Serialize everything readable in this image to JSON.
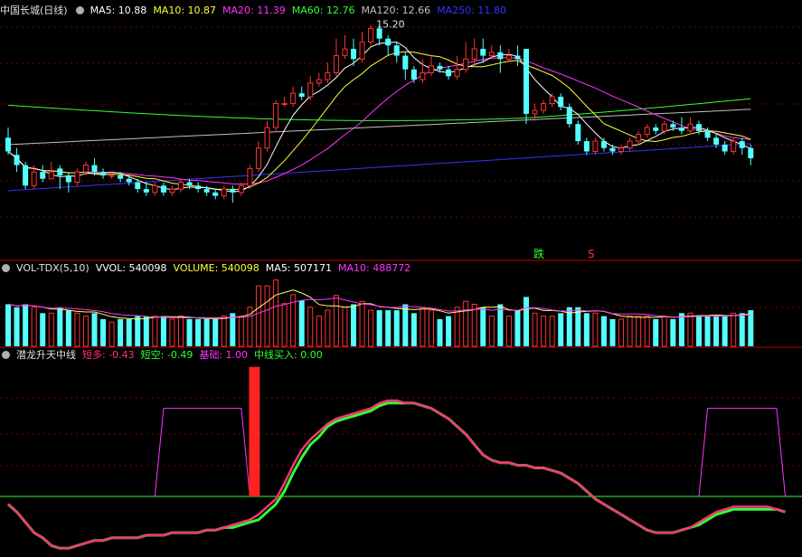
{
  "chart_data": [
    {
      "type": "candlestick",
      "title": "中国长城(日线)",
      "legend": [
        {
          "label": "MA5: 10.88",
          "color": "#ffffff"
        },
        {
          "label": "MA10: 10.87",
          "color": "#ffff33"
        },
        {
          "label": "MA20: 11.39",
          "color": "#ff33ff"
        },
        {
          "label": "MA60: 12.76",
          "color": "#33ff33"
        },
        {
          "label": "MA120: 12.66",
          "color": "#c0c0c0"
        },
        {
          "label": "MA250: 11.80",
          "color": "#3333ff"
        }
      ],
      "ylim": [
        9.0,
        15.4
      ],
      "high_label": "15.20",
      "signals": [
        {
          "text": "跌",
          "color": "#33ff33"
        },
        {
          "text": "S",
          "color": "#ff3333"
        }
      ],
      "candles": [
        [
          11.9,
          11.5,
          12.2,
          11.4
        ],
        [
          11.4,
          11.1,
          11.6,
          10.9
        ],
        [
          11.1,
          10.5,
          11.2,
          10.4
        ],
        [
          10.5,
          10.9,
          11.1,
          10.4
        ],
        [
          10.9,
          10.7,
          11.1,
          10.6
        ],
        [
          10.7,
          10.9,
          11.2,
          10.7
        ],
        [
          11.0,
          10.8,
          11.1,
          10.4
        ],
        [
          10.8,
          10.6,
          10.9,
          10.3
        ],
        [
          10.6,
          10.9,
          11.0,
          10.5
        ],
        [
          10.9,
          11.1,
          11.2,
          10.8
        ],
        [
          11.1,
          10.9,
          11.3,
          10.8
        ],
        [
          10.9,
          10.8,
          11.0,
          10.7
        ],
        [
          10.8,
          10.8,
          10.9,
          10.7
        ],
        [
          10.8,
          10.7,
          10.9,
          10.6
        ],
        [
          10.7,
          10.6,
          10.8,
          10.5
        ],
        [
          10.6,
          10.4,
          10.7,
          10.3
        ],
        [
          10.4,
          10.3,
          10.6,
          10.2
        ],
        [
          10.3,
          10.5,
          10.6,
          10.2
        ],
        [
          10.5,
          10.3,
          10.6,
          10.2
        ],
        [
          10.3,
          10.4,
          10.5,
          10.2
        ],
        [
          10.4,
          10.6,
          10.7,
          10.3
        ],
        [
          10.6,
          10.5,
          10.7,
          10.4
        ],
        [
          10.5,
          10.4,
          10.6,
          10.3
        ],
        [
          10.4,
          10.3,
          10.5,
          10.2
        ],
        [
          10.3,
          10.2,
          10.4,
          10.1
        ],
        [
          10.2,
          10.4,
          10.5,
          10.1
        ],
        [
          10.4,
          10.3,
          10.5,
          10.0
        ],
        [
          10.3,
          10.5,
          10.6,
          10.2
        ],
        [
          10.5,
          11.0,
          11.1,
          10.4
        ],
        [
          11.0,
          11.6,
          11.8,
          10.9
        ],
        [
          11.6,
          12.2,
          12.4,
          11.5
        ],
        [
          12.2,
          12.9,
          13.0,
          12.1
        ],
        [
          12.9,
          12.9,
          13.1,
          12.8
        ],
        [
          12.9,
          13.2,
          13.4,
          12.8
        ],
        [
          13.2,
          13.1,
          13.4,
          13.0
        ],
        [
          13.1,
          13.5,
          13.7,
          13.0
        ],
        [
          13.5,
          13.6,
          13.8,
          13.4
        ],
        [
          13.6,
          13.8,
          14.1,
          13.5
        ],
        [
          13.8,
          14.3,
          14.8,
          13.7
        ],
        [
          14.3,
          14.5,
          14.9,
          14.2
        ],
        [
          14.5,
          14.2,
          14.8,
          14.0
        ],
        [
          14.2,
          14.7,
          15.0,
          14.1
        ],
        [
          14.7,
          15.1,
          15.2,
          14.6
        ],
        [
          15.1,
          14.8,
          15.2,
          14.6
        ],
        [
          14.8,
          14.6,
          14.9,
          14.3
        ],
        [
          14.6,
          14.3,
          14.7,
          14.1
        ],
        [
          14.3,
          13.9,
          14.4,
          13.6
        ],
        [
          13.9,
          13.6,
          14.0,
          13.5
        ],
        [
          13.6,
          13.8,
          14.2,
          13.5
        ],
        [
          13.8,
          14.0,
          14.3,
          13.7
        ],
        [
          14.0,
          13.9,
          14.1,
          13.8
        ],
        [
          13.9,
          13.7,
          14.0,
          13.6
        ],
        [
          13.7,
          13.9,
          14.3,
          13.6
        ],
        [
          13.9,
          14.2,
          14.7,
          13.8
        ],
        [
          14.2,
          14.5,
          14.8,
          14.0
        ],
        [
          14.5,
          14.3,
          14.8,
          14.1
        ],
        [
          14.3,
          14.4,
          14.6,
          14.2
        ],
        [
          14.4,
          14.2,
          14.6,
          13.8
        ],
        [
          14.2,
          14.3,
          14.5,
          14.1
        ],
        [
          14.3,
          14.2,
          14.6,
          14.0
        ],
        [
          14.5,
          12.6,
          14.5,
          12.3
        ],
        [
          12.6,
          12.7,
          12.9,
          12.4
        ],
        [
          12.7,
          12.9,
          13.0,
          12.6
        ],
        [
          12.9,
          13.1,
          13.2,
          12.8
        ],
        [
          13.1,
          12.8,
          13.2,
          12.7
        ],
        [
          12.8,
          12.3,
          12.9,
          12.2
        ],
        [
          12.3,
          11.8,
          12.4,
          11.7
        ],
        [
          11.8,
          11.5,
          11.9,
          11.4
        ],
        [
          11.5,
          11.8,
          11.9,
          11.4
        ],
        [
          11.8,
          11.6,
          11.9,
          11.5
        ],
        [
          11.6,
          11.5,
          11.7,
          11.4
        ],
        [
          11.5,
          11.6,
          11.7,
          11.4
        ],
        [
          11.6,
          11.8,
          11.9,
          11.5
        ],
        [
          11.8,
          12.0,
          12.1,
          11.7
        ],
        [
          12.0,
          12.2,
          12.3,
          11.9
        ],
        [
          12.2,
          12.1,
          12.3,
          12.0
        ],
        [
          12.1,
          12.3,
          12.4,
          12.0
        ],
        [
          12.3,
          12.2,
          12.4,
          12.1
        ],
        [
          12.2,
          12.1,
          12.5,
          12.0
        ],
        [
          12.1,
          12.3,
          12.5,
          12.0
        ],
        [
          12.3,
          12.1,
          12.4,
          12.0
        ],
        [
          12.1,
          11.9,
          12.2,
          11.8
        ],
        [
          11.9,
          11.7,
          12.0,
          11.6
        ],
        [
          11.7,
          11.5,
          11.8,
          11.4
        ],
        [
          11.5,
          11.8,
          11.9,
          11.4
        ],
        [
          11.8,
          11.6,
          11.9,
          11.4
        ],
        [
          11.6,
          11.3,
          11.7,
          11.1
        ]
      ]
    },
    {
      "type": "bar",
      "title": "VOL-TDX(5,10)",
      "legend": [
        {
          "label": "VVOL: 540098",
          "color": "#ffffff"
        },
        {
          "label": "VOLUME: 540098",
          "color": "#ffff33"
        },
        {
          "label": "MA5: 507171",
          "color": "#ffffff"
        },
        {
          "label": "MA10: 488772",
          "color": "#ff33ff"
        }
      ],
      "ylim": [
        0,
        1000000
      ]
    },
    {
      "type": "line",
      "title": "潜龙升天中线",
      "legend": [
        {
          "label": "短多: -0.43",
          "color": "#ff3377"
        },
        {
          "label": "短空: -0.49",
          "color": "#33ff33"
        },
        {
          "label": "基础: 1.00",
          "color": "#ff33ff"
        },
        {
          "label": "中线买入: 0.00",
          "color": "#33ff33"
        }
      ],
      "ylim": [
        -2.2,
        5.2
      ],
      "markers": [
        {
          "index": 28,
          "value": 5.0,
          "color": "#ff2222"
        }
      ],
      "series": [
        {
          "name": "短多",
          "color": "#ff3377",
          "values": [
            -0.3,
            -0.6,
            -1.0,
            -1.4,
            -1.6,
            -1.9,
            -2.0,
            -2.0,
            -1.9,
            -1.8,
            -1.7,
            -1.7,
            -1.6,
            -1.6,
            -1.6,
            -1.6,
            -1.5,
            -1.5,
            -1.5,
            -1.4,
            -1.4,
            -1.4,
            -1.4,
            -1.3,
            -1.3,
            -1.2,
            -1.1,
            -1.0,
            -0.9,
            -0.7,
            -0.4,
            -0.1,
            0.5,
            1.2,
            1.8,
            2.2,
            2.5,
            2.8,
            3.0,
            3.1,
            3.2,
            3.3,
            3.4,
            3.6,
            3.7,
            3.7,
            3.6,
            3.6,
            3.5,
            3.4,
            3.2,
            3.0,
            2.7,
            2.4,
            2.0,
            1.6,
            1.4,
            1.3,
            1.3,
            1.2,
            1.2,
            1.1,
            1.1,
            1.0,
            0.9,
            0.7,
            0.5,
            0.2,
            -0.1,
            -0.3,
            -0.5,
            -0.7,
            -0.9,
            -1.1,
            -1.3,
            -1.4,
            -1.4,
            -1.4,
            -1.3,
            -1.2,
            -1.0,
            -0.8,
            -0.6,
            -0.5,
            -0.4,
            -0.4,
            -0.4,
            -0.4,
            -0.4,
            -0.5,
            -0.6
          ]
        },
        {
          "name": "短空",
          "color": "#33ff33",
          "values": [
            -0.3,
            -0.6,
            -1.0,
            -1.4,
            -1.6,
            -1.9,
            -2.0,
            -2.0,
            -1.9,
            -1.8,
            -1.7,
            -1.7,
            -1.6,
            -1.6,
            -1.6,
            -1.6,
            -1.5,
            -1.5,
            -1.5,
            -1.4,
            -1.4,
            -1.4,
            -1.4,
            -1.3,
            -1.3,
            -1.2,
            -1.2,
            -1.1,
            -1.0,
            -0.9,
            -0.6,
            -0.3,
            0.2,
            0.9,
            1.5,
            2.0,
            2.3,
            2.7,
            2.9,
            3.0,
            3.1,
            3.2,
            3.3,
            3.5,
            3.6,
            3.6,
            3.6,
            3.6,
            3.5,
            3.4,
            3.2,
            3.0,
            2.7,
            2.4,
            2.0,
            1.6,
            1.4,
            1.3,
            1.3,
            1.2,
            1.2,
            1.1,
            1.1,
            1.0,
            0.9,
            0.7,
            0.5,
            0.2,
            -0.1,
            -0.3,
            -0.5,
            -0.7,
            -0.9,
            -1.1,
            -1.3,
            -1.4,
            -1.4,
            -1.4,
            -1.3,
            -1.2,
            -1.1,
            -0.9,
            -0.7,
            -0.6,
            -0.5,
            -0.5,
            -0.5,
            -0.5,
            -0.5,
            -0.5,
            -0.6
          ]
        }
      ],
      "base_series": {
        "name": "基础",
        "color": "#ff33ff",
        "values": [
          0,
          0,
          0,
          0,
          0,
          0,
          0,
          0,
          0,
          0,
          0,
          0,
          0,
          0,
          0,
          0,
          0,
          0,
          0,
          0,
          0,
          0,
          0,
          0,
          0,
          0,
          0,
          0,
          0,
          0,
          0,
          0,
          0,
          0,
          0,
          0,
          0,
          0,
          0,
          0,
          0,
          0,
          0,
          0,
          0,
          0,
          0,
          0,
          0,
          0,
          0,
          0,
          0,
          0,
          0,
          0,
          0,
          0,
          0,
          0,
          0,
          0,
          0,
          0,
          0,
          0,
          0,
          0,
          0,
          0,
          0,
          0,
          0,
          0,
          0,
          0,
          0,
          0,
          0,
          0,
          0,
          0,
          0,
          0,
          0,
          0,
          0,
          0,
          0,
          0,
          0
        ]
      }
    }
  ]
}
